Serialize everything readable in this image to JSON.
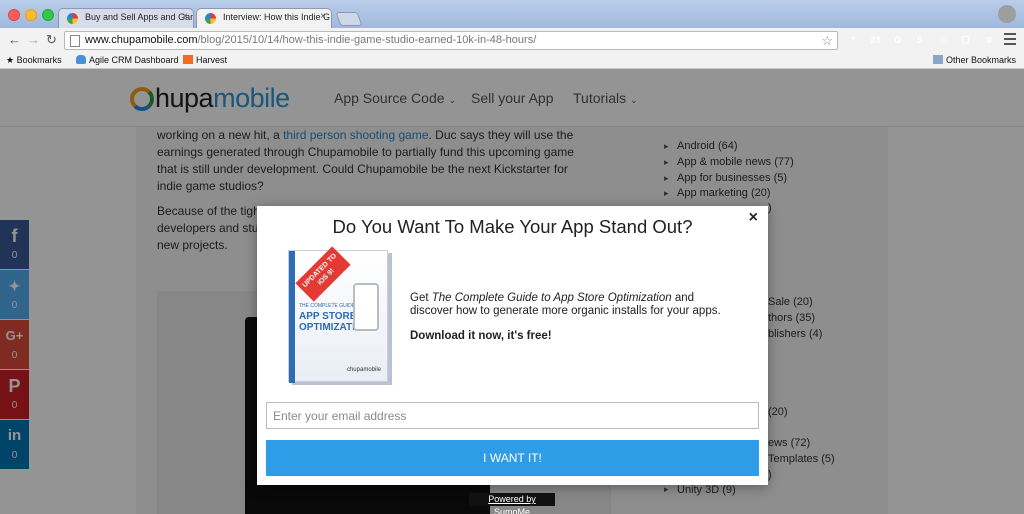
{
  "browser": {
    "tabs": [
      {
        "title": "Buy and Sell Apps and Gam",
        "close": "×"
      },
      {
        "title": "Interview: How this Indie G",
        "close": "×"
      }
    ],
    "nav": {
      "back": "←",
      "forward": "→",
      "reload": "↻"
    },
    "url_host": "www.chupamobile.com",
    "url_path": "/blog/2015/10/14/how-this-indie-game-studio-earned-10k-in-48-hours/",
    "star": "☆",
    "extensions": [
      {
        "icon": "lastpass-icon",
        "label": "*",
        "color": "#d32f2f"
      },
      {
        "icon": "stats-icon",
        "label": "23",
        "color": "#37474f"
      },
      {
        "icon": "grammarly-icon",
        "label": "G",
        "color": "#15c39a"
      },
      {
        "icon": "skype-icon",
        "label": "S",
        "color": "#00aff0"
      },
      {
        "icon": "screenshot-icon",
        "label": "□",
        "color": "#78909c"
      },
      {
        "icon": "copy-icon",
        "label": "❐",
        "color": "#90a4ae"
      },
      {
        "icon": "badge-icon",
        "label": "0",
        "color": "#2196f3"
      }
    ],
    "bookmarks": {
      "label": "Bookmarks",
      "items": [
        "Agile CRM Dashboard",
        "Harvest"
      ],
      "other": "Other Bookmarks"
    }
  },
  "site": {
    "logo": {
      "bold": "hupa",
      "light": "mobile"
    },
    "nav": [
      {
        "label": "App Source Code",
        "caret": "⌄"
      },
      {
        "label": "Sell your App"
      },
      {
        "label": "Tutorials",
        "caret": "⌄"
      }
    ],
    "article": {
      "p1_before": "working on a new hit, a ",
      "p1_link": "third person shooting game",
      "p1_after": ". Duc says they will use the earnings generated through Chupamobile to partially fund this upcoming game that is still under development. Could Chupamobile be the next Kickstarter for indie game studios?",
      "p2": "Because of the tight competition on the app stores, hundreds of indie app developers and studios are looking for alternative option wh stores. Most develop new projects."
    },
    "sidebar": [
      "Android (64)",
      "App & mobile news (77)",
      "App for businesses (5)",
      "App marketing (20)"
    ],
    "sidebar_fragments": [
      {
        "text": ")"
      },
      {
        "text": "Sale (20)"
      },
      {
        "text": "thors (35)"
      },
      {
        "text": "blishers (4)"
      },
      {
        "text": "(20)"
      },
      {
        "text": "ews (72)"
      },
      {
        "text": "Templates (5)"
      },
      {
        "text": ")"
      },
      {
        "text": "Unity 3D (9)"
      }
    ],
    "share": [
      {
        "network": "facebook",
        "glyph": "f",
        "count": "0",
        "color": "#3b5998"
      },
      {
        "network": "twitter",
        "glyph": "🐦",
        "count": "0",
        "color": "#55acee"
      },
      {
        "network": "google-plus",
        "glyph": "G+",
        "count": "0",
        "color": "#dd4b39"
      },
      {
        "network": "pinterest",
        "glyph": "P",
        "count": "0",
        "color": "#cb2027"
      },
      {
        "network": "linkedin",
        "glyph": "in",
        "count": "0",
        "color": "#0077b5"
      }
    ]
  },
  "modal": {
    "title": "Do You Want To Make Your App Stand Out?",
    "close": "×",
    "book": {
      "ribbon": "UPDATED TO iOS 9!",
      "subtitle": "THE COMPLETE GUIDE TO",
      "title": "APP STORE OPTIMIZATION",
      "brand": "chupamobile"
    },
    "copy_before": "Get ",
    "copy_emph": "The Complete Guide to App Store Optimization",
    "copy_after": " and discover how to generate more organic installs for your apps.",
    "strong": "Download it now, it's free!",
    "email_placeholder": "Enter your email address",
    "button": "I WANT IT!",
    "powered_by": "Powered by SumoMe"
  }
}
